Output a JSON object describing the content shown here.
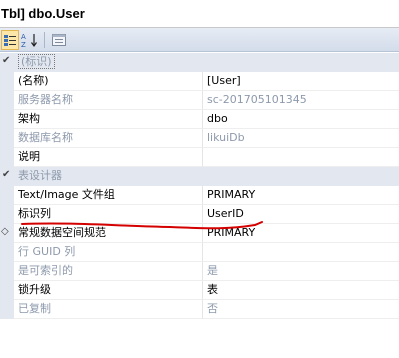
{
  "window": {
    "title": "Tbl] dbo.User"
  },
  "toolbar": {
    "buttons": [
      "categorized-icon",
      "alphabetical-icon",
      "property-pages-icon"
    ]
  },
  "categories": [
    {
      "label": "(标识)",
      "rows": [
        {
          "name": "(名称)",
          "value": "[User]",
          "disabled": false
        },
        {
          "name": "服务器名称",
          "value": "sc-201705101345",
          "disabled": true
        },
        {
          "name": "架构",
          "value": "dbo",
          "disabled": false
        },
        {
          "name": "数据库名称",
          "value": "likuiDb",
          "disabled": true
        },
        {
          "name": "说明",
          "value": "",
          "disabled": false
        }
      ]
    },
    {
      "label": "表设计器",
      "rows": [
        {
          "name": "Text/Image 文件组",
          "value": "PRIMARY",
          "disabled": false
        },
        {
          "name": "标识列",
          "value": "UserID",
          "disabled": false
        },
        {
          "name": "常规数据空间规范",
          "value": "PRIMARY",
          "disabled": false,
          "expandable": true
        },
        {
          "name": "行 GUID 列",
          "value": "",
          "disabled": true
        },
        {
          "name": "是可索引的",
          "value": "是",
          "disabled": true
        },
        {
          "name": "锁升级",
          "value": "表",
          "disabled": false
        },
        {
          "name": "已复制",
          "value": "否",
          "disabled": true
        }
      ]
    }
  ],
  "colors": {
    "category_bg": "#e3e8f0",
    "disabled_text": "#8d99ab",
    "annotation_line": "#d40000"
  }
}
